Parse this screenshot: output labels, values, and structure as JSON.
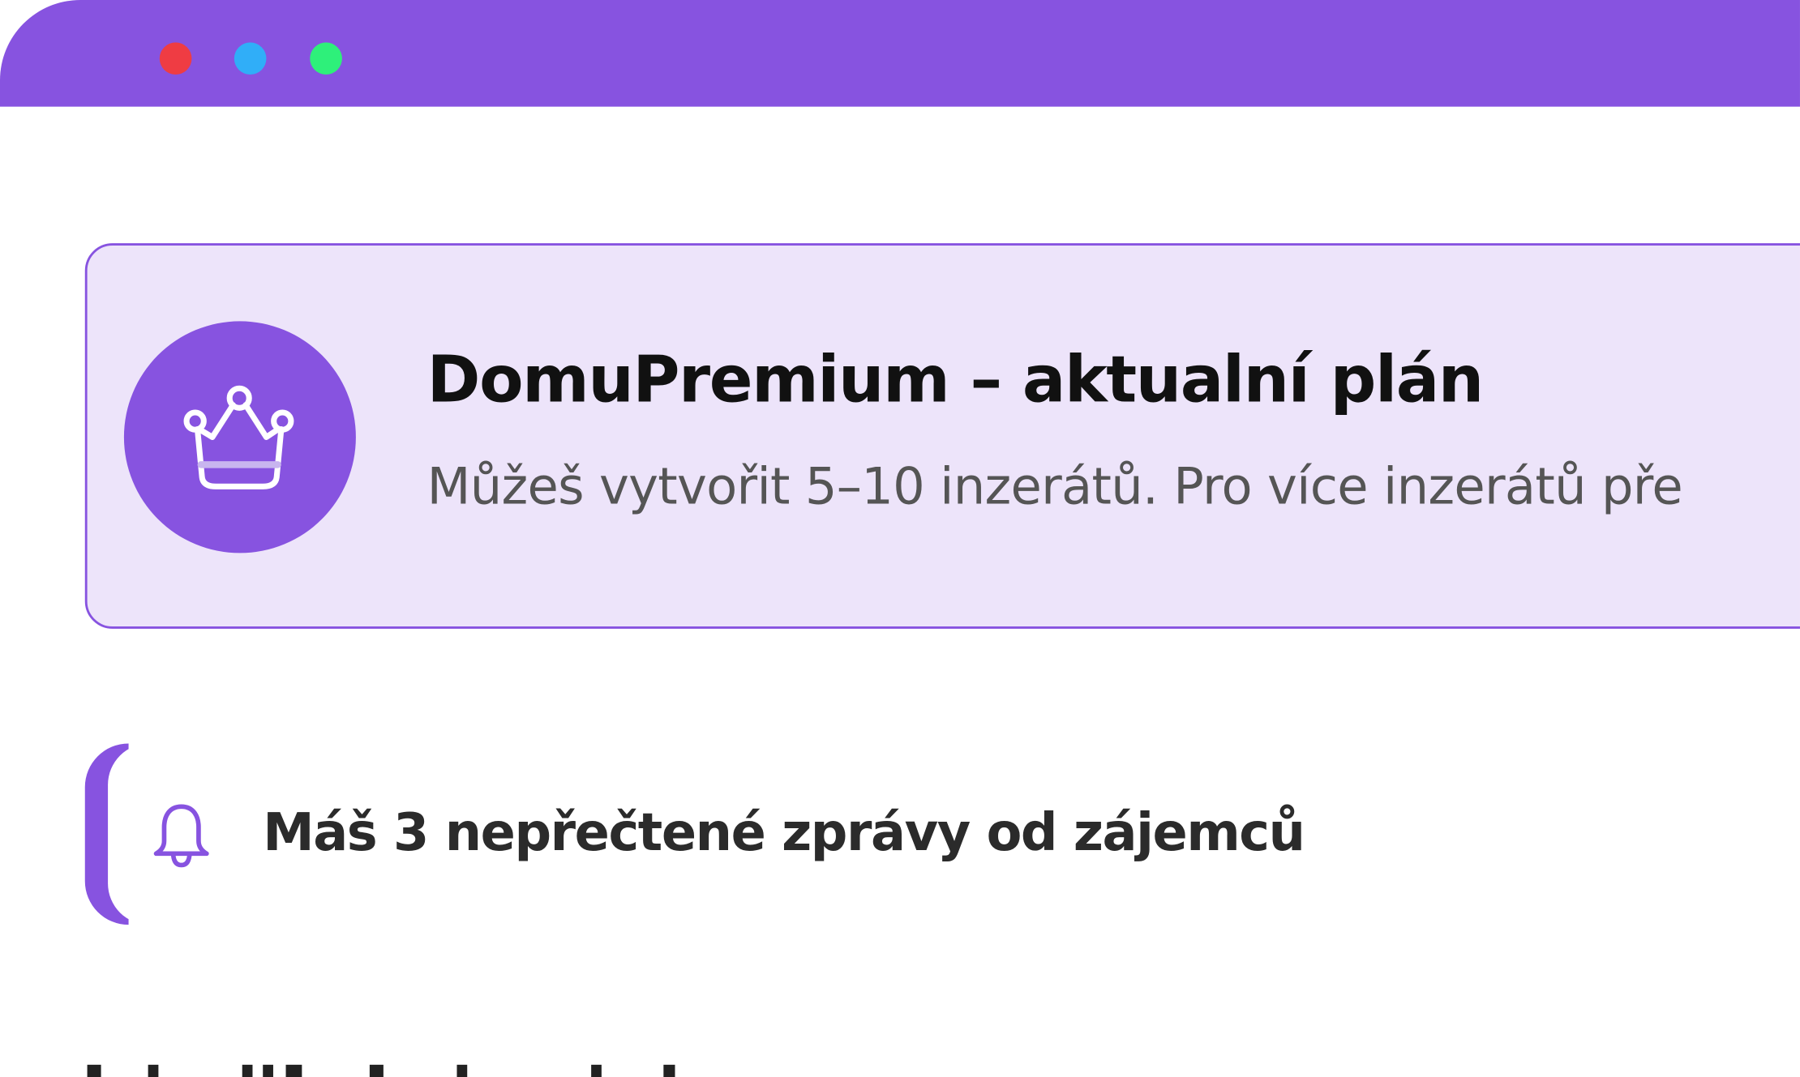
{
  "window": {
    "controls": [
      "close",
      "minimize",
      "maximize"
    ],
    "colors": {
      "titlebar": "#8753e0",
      "close": "#ef3c43",
      "minimize": "#30aef8",
      "maximize": "#2ef07a"
    }
  },
  "plan": {
    "icon": "crown-icon",
    "title": "DomuPremium – aktualní plán",
    "description": "Můžeš vytvořit 5–10 inzerátů. Pro více inzerátů pře",
    "colors": {
      "border": "#8753e0",
      "background": "#ede4fa"
    }
  },
  "notification": {
    "icon": "bell-icon",
    "text": "Máš 3 nepřečtené zprávy od zájemců",
    "accent_color": "#8753e0"
  }
}
